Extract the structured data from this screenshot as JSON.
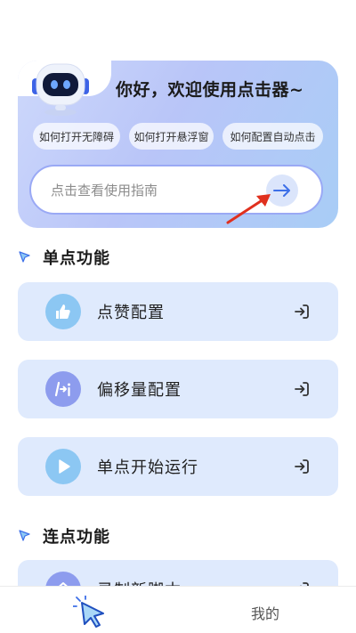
{
  "hero": {
    "title": "你好，欢迎使用点击器~",
    "faq_chips": [
      "如何打开无障碍",
      "如何打开悬浮窗",
      "如何配置自动点击"
    ],
    "search_placeholder": "点击查看使用指南"
  },
  "sections": {
    "single": {
      "title": "单点功能",
      "cards": [
        {
          "label": "点赞配置",
          "icon": "thumbs-up-icon",
          "icon_color": "#8cc7f3"
        },
        {
          "label": "偏移量配置",
          "icon": "offset-icon",
          "icon_color": "#8d9cee"
        },
        {
          "label": "单点开始运行",
          "icon": "play-icon",
          "icon_color": "#8cc7f3"
        }
      ]
    },
    "multi": {
      "title": "连点功能",
      "cards": [
        {
          "label": "录制新脚本",
          "icon": "home-icon",
          "icon_color": "#8d9cee"
        }
      ]
    }
  },
  "bottom_nav": {
    "tab_home_icon": "cursor-click-icon",
    "tab_mine": "我的"
  },
  "colors": {
    "accent": "#3d6fe8",
    "card_bg": "#dfeafd",
    "hero_gradient_start": "#cdd8fb",
    "hero_gradient_end": "#a8cdf6",
    "annotation_arrow": "#e0301e"
  }
}
